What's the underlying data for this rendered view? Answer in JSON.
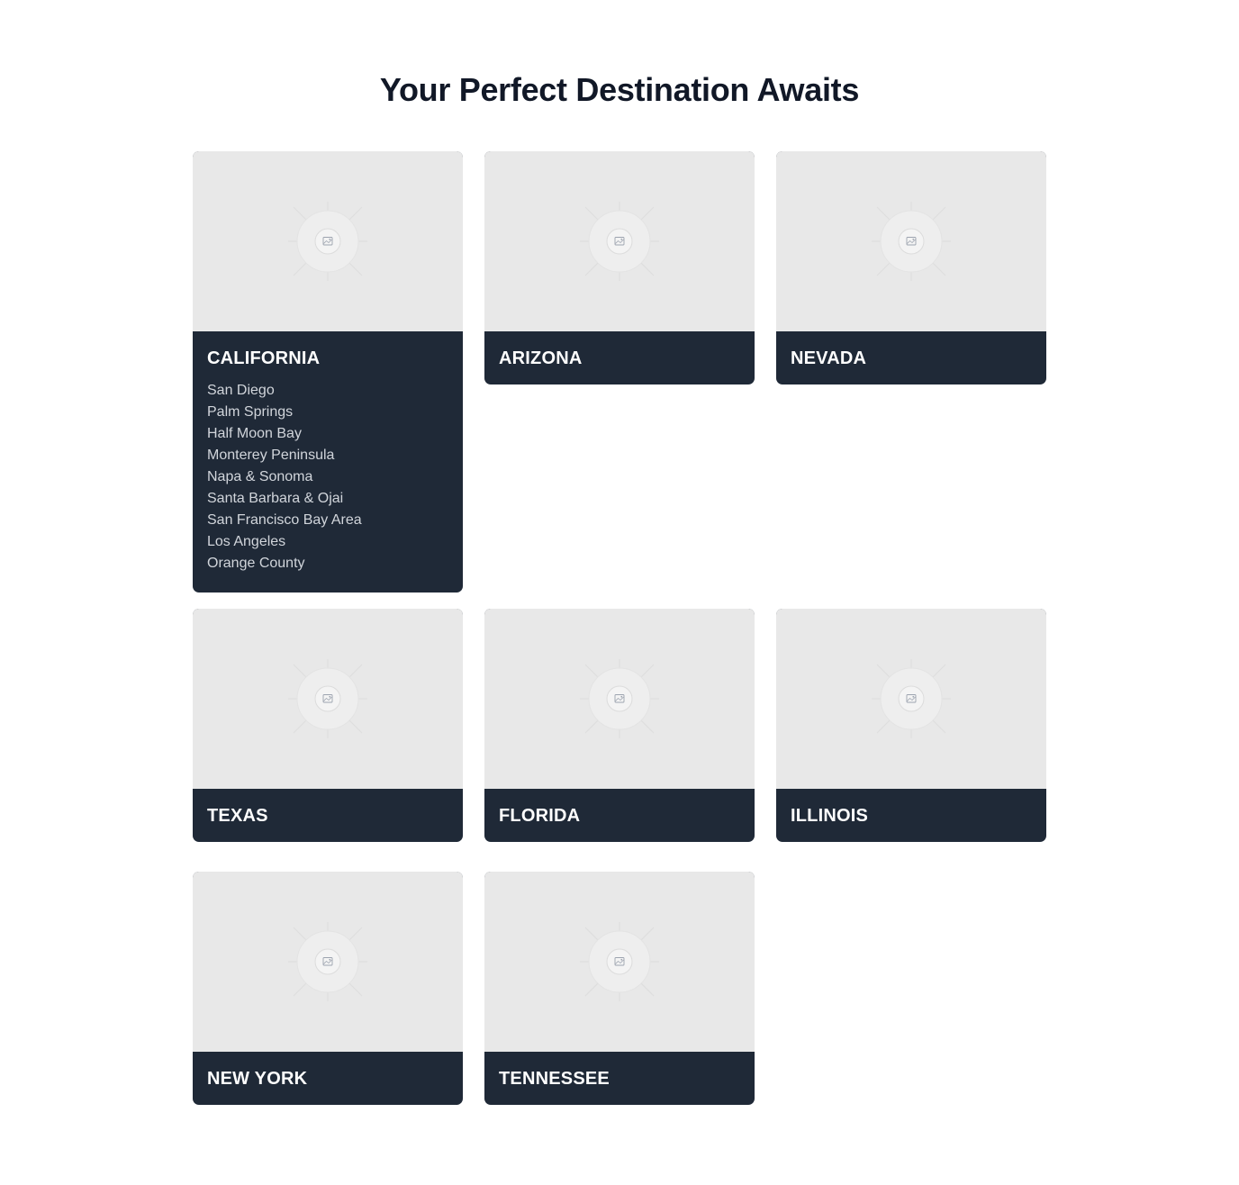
{
  "page": {
    "title": "Your Perfect Destination Awaits"
  },
  "icons": {
    "placeholder": "image-placeholder-icon"
  },
  "colors": {
    "title": "#111827",
    "card_footer": "#1f2937",
    "image_placeholder": "#e8e8e8",
    "card_title": "#ffffff",
    "city_text": "#d1d5db"
  },
  "destinations": [
    {
      "name": "CALIFORNIA",
      "cities": [
        "San Diego",
        "Palm Springs",
        "Half Moon Bay",
        "Monterey Peninsula",
        "Napa & Sonoma",
        "Santa Barbara & Ojai",
        "San Francisco Bay Area",
        "Los Angeles",
        "Orange County"
      ]
    },
    {
      "name": "ARIZONA"
    },
    {
      "name": "NEVADA"
    },
    {
      "name": "TEXAS"
    },
    {
      "name": "FLORIDA"
    },
    {
      "name": "ILLINOIS"
    },
    {
      "name": "NEW YORK"
    },
    {
      "name": "TENNESSEE"
    }
  ]
}
